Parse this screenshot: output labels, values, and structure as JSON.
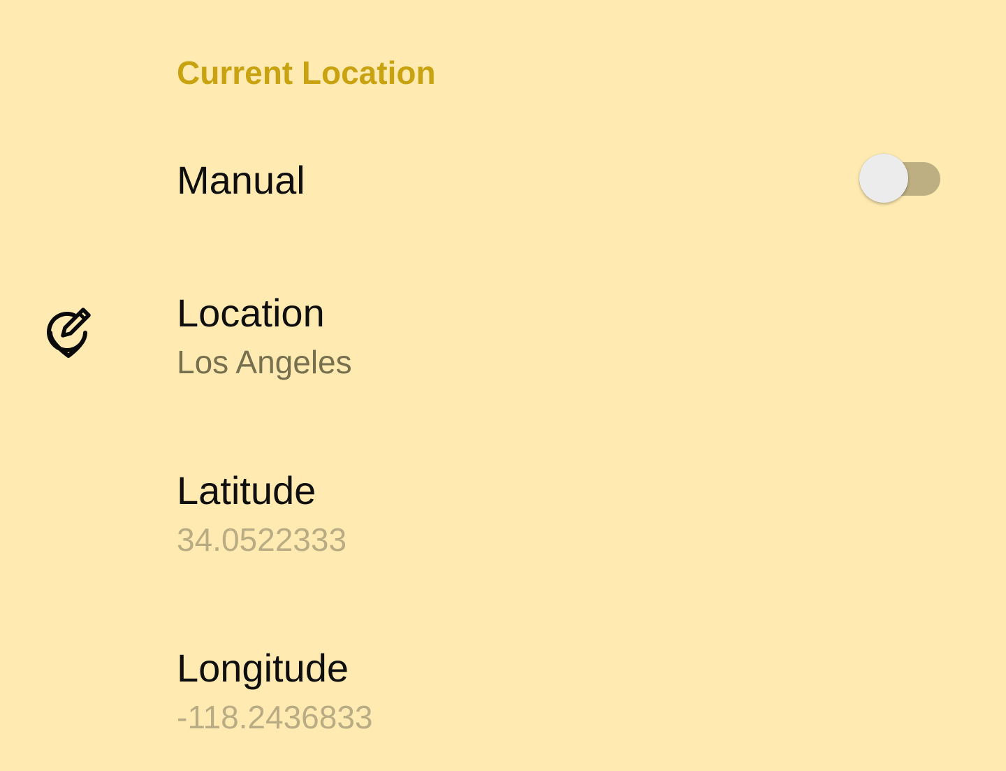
{
  "section": {
    "title": "Current Location",
    "title_color": "#C9A212"
  },
  "theme": {
    "background": "#FFEBB1",
    "switch_track": "#BEAF82",
    "switch_thumb": "#ECECEC"
  },
  "preferences": {
    "manual": {
      "title": "Manual",
      "enabled": false
    },
    "location": {
      "title": "Location",
      "summary": "Los Angeles",
      "icon": "edit-location-icon"
    },
    "latitude": {
      "title": "Latitude",
      "summary": "34.0522333"
    },
    "longitude": {
      "title": "Longitude",
      "summary": "-118.2436833"
    }
  }
}
